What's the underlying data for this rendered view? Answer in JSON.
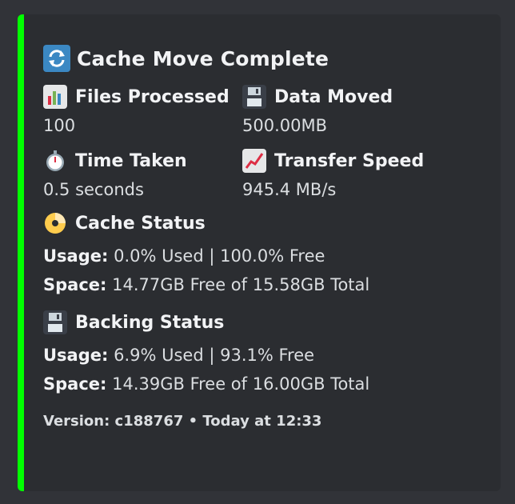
{
  "embed": {
    "accent_color": "#00ff00",
    "title": "Cache Move Complete",
    "title_icon": "refresh-icon",
    "fields": [
      {
        "icon": "bar-chart-icon",
        "name": "Files Processed",
        "value": "100"
      },
      {
        "icon": "floppy-disk-icon",
        "name": "Data Moved",
        "value": "500.00MB"
      },
      {
        "icon": "stopwatch-icon",
        "name": "Time Taken",
        "value": "0.5 seconds"
      },
      {
        "icon": "trending-up-chart-icon",
        "name": "Transfer Speed",
        "value": "945.4 MB/s"
      }
    ],
    "cache_status": {
      "icon": "cd-disc-icon",
      "name": "Cache Status",
      "usage_label": "Usage:",
      "usage_value": " 0.0% Used | 100.0% Free",
      "space_label": "Space:",
      "space_value": " 14.77GB Free of 15.58GB Total"
    },
    "backing_status": {
      "icon": "floppy-disk-icon",
      "name": "Backing Status",
      "usage_label": "Usage:",
      "usage_value": " 6.9% Used | 93.1% Free",
      "space_label": "Space:",
      "space_value": " 14.39GB Free of 16.00GB Total"
    },
    "footer": "Version: c188767 • Today at 12:33"
  }
}
